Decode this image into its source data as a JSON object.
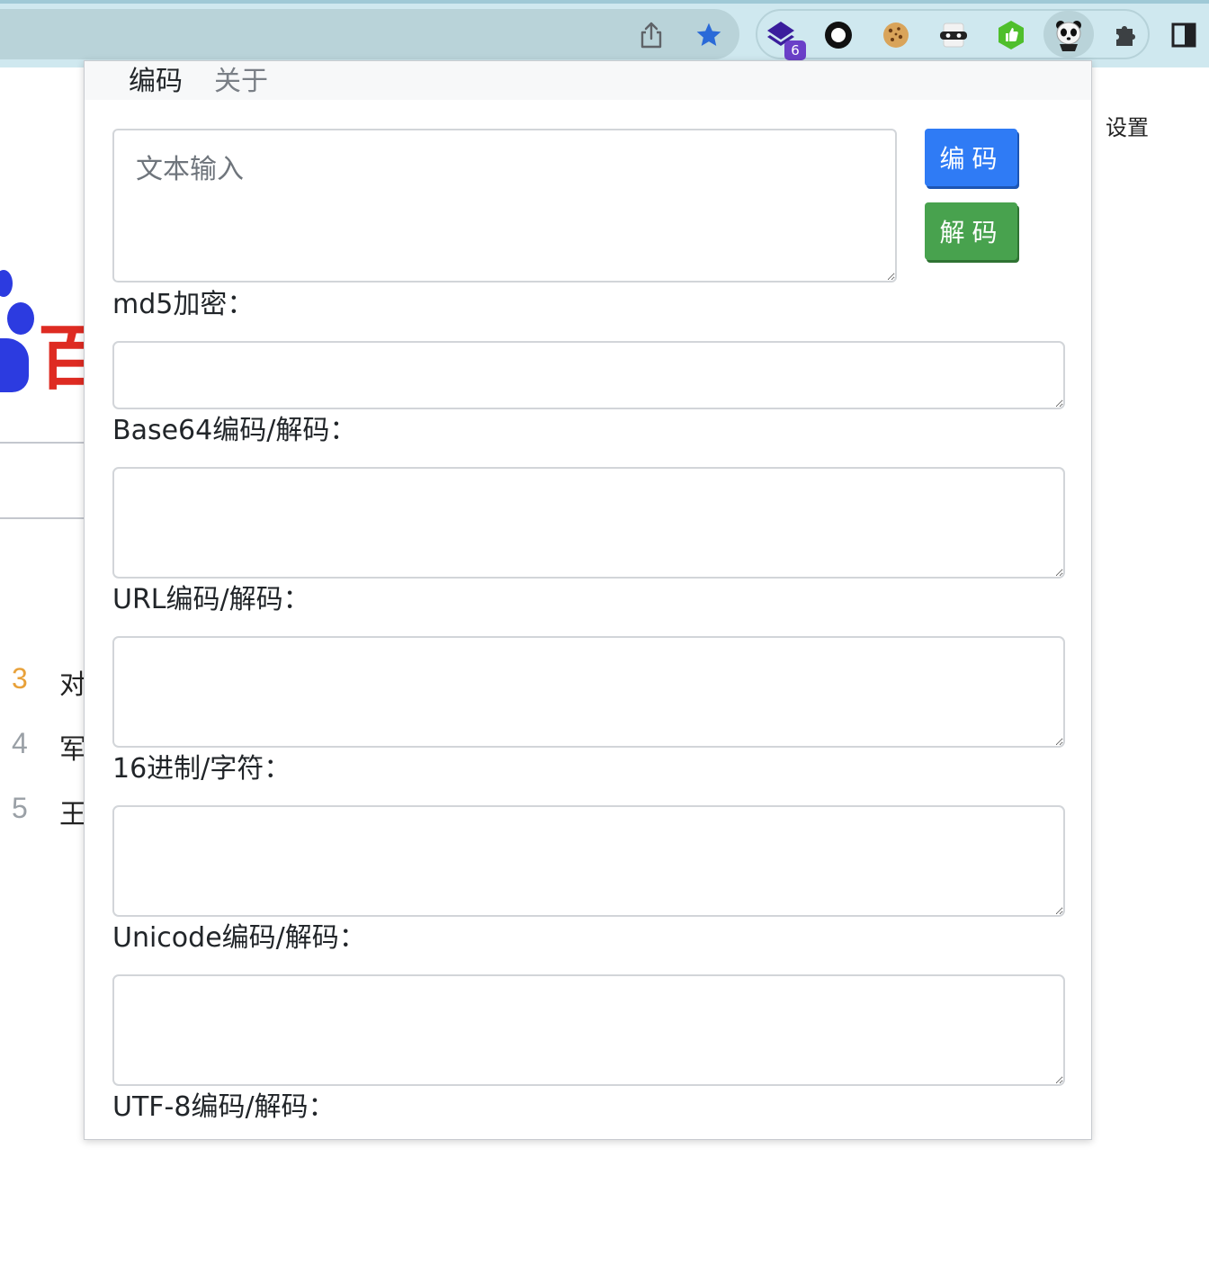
{
  "browser": {
    "extension_badge_count": "6",
    "icons": [
      "share-icon",
      "bookmark-star-icon",
      "layers-extension-icon",
      "circle-extension-icon",
      "cookie-extension-icon",
      "mask-extension-icon",
      "thumbs-up-extension-icon",
      "panda-extension-icon",
      "puzzle-extensions-icon",
      "side-panel-icon"
    ]
  },
  "background_page": {
    "logo_text": "百",
    "settings": "设置",
    "ranks": [
      {
        "num": "3",
        "text": "对",
        "color": "#e8a13a"
      },
      {
        "num": "4",
        "text": "军",
        "color": "#9aa0a6"
      },
      {
        "num": "5",
        "text": "王",
        "color": "#9aa0a6"
      }
    ]
  },
  "popup": {
    "tabs": {
      "encode": "编码",
      "about": "关于"
    },
    "input_placeholder": "文本输入",
    "buttons": {
      "encode": "编码",
      "decode": "解码"
    },
    "fields": {
      "md5": "md5加密：",
      "base64": "Base64编码/解码：",
      "url": "URL编码/解码：",
      "hex": "16进制/字符：",
      "unicode": "Unicode编码/解码：",
      "utf8": "UTF-8编码/解码："
    }
  },
  "colors": {
    "encode_button": "#2f7bf5",
    "decode_button": "#48a24e",
    "logo_red": "#de2b22",
    "logo_blue": "#2c3be0"
  }
}
